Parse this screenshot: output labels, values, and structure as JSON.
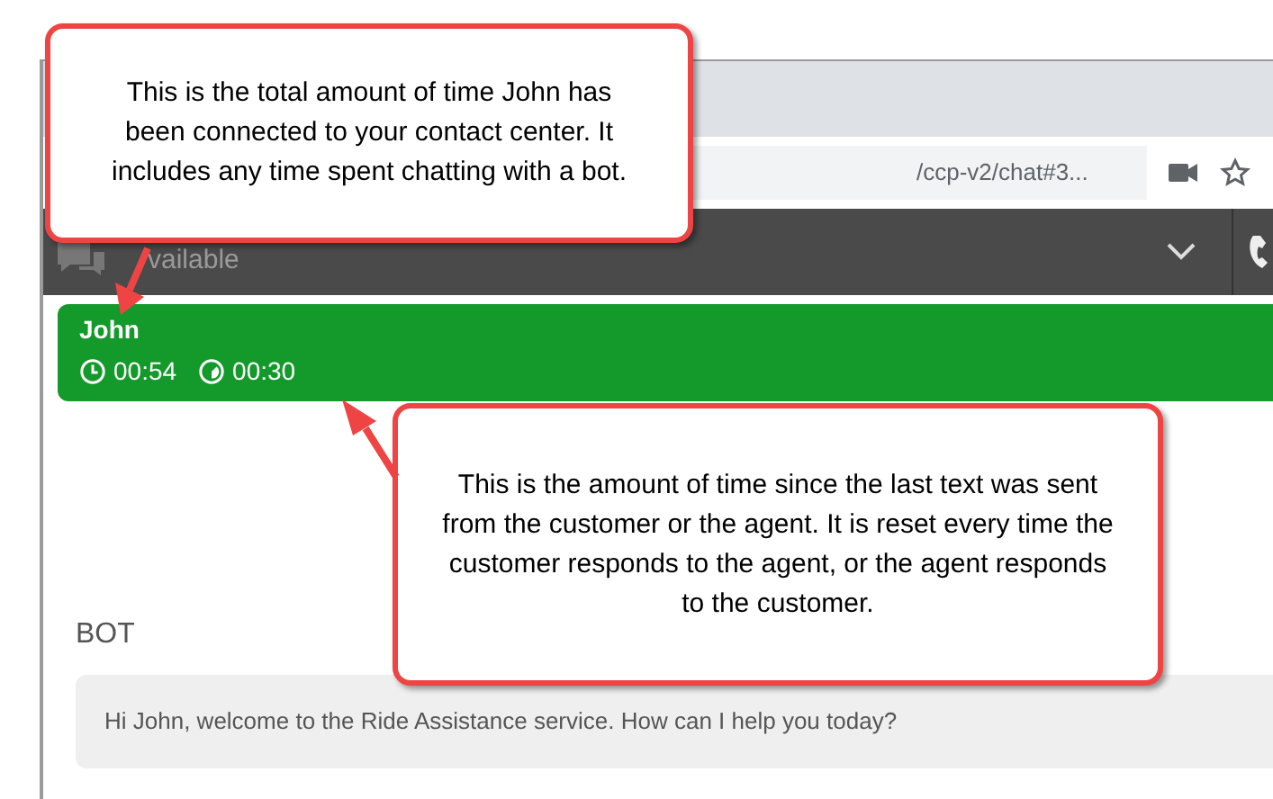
{
  "browser": {
    "url": "/ccp-v2/chat#3..."
  },
  "agent_bar": {
    "status": "vailable"
  },
  "contact": {
    "name": "John",
    "total_time": "00:54",
    "since_last_text": "00:30"
  },
  "chat": {
    "sender": "BOT",
    "message": "Hi John, welcome to the Ride Assistance service. How can I help you today?"
  },
  "callouts": [
    {
      "text": "This is the total amount of time John has been connected to your contact center. It includes any time spent chatting with a bot."
    },
    {
      "text": "This is the amount of time since the last text was sent from the customer or the agent. It is reset every time the customer responds to the agent, or the agent responds to the customer."
    }
  ]
}
